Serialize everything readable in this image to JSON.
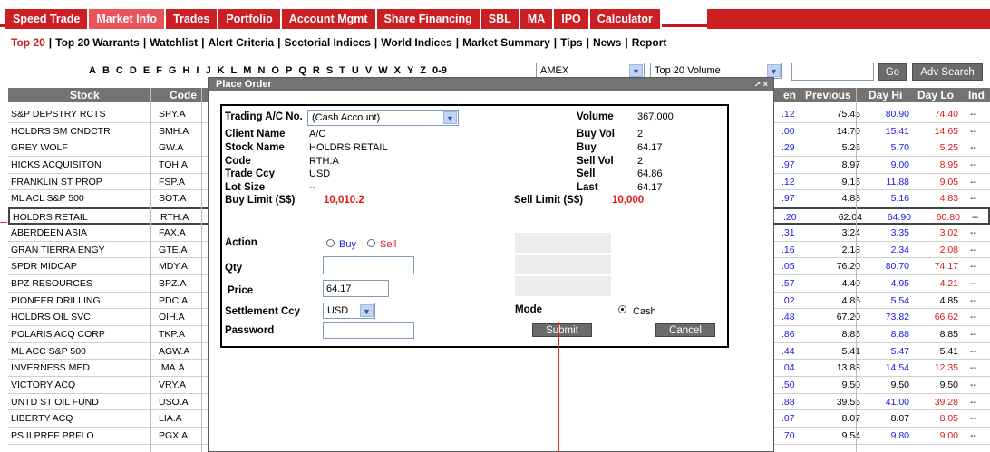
{
  "nav": {
    "tabs": [
      "Speed Trade",
      "Market Info",
      "Trades",
      "Portfolio",
      "Account Mgmt",
      "Share Financing",
      "SBL",
      "MA",
      "IPO",
      "Calculator"
    ],
    "active_tab": "Market Info"
  },
  "subnav": [
    "Top 20",
    "Top 20 Warrants",
    "Watchlist",
    "Alert Criteria",
    "Sectorial Indices",
    "World Indices",
    "Market Summary",
    "Tips",
    "News",
    "Report"
  ],
  "filter": {
    "letters": [
      "A",
      "B",
      "C",
      "D",
      "E",
      "F",
      "G",
      "H",
      "I",
      "J",
      "K",
      "L",
      "M",
      "N",
      "O",
      "P",
      "Q",
      "R",
      "S",
      "T",
      "U",
      "V",
      "W",
      "X",
      "Y",
      "Z",
      "0-9"
    ],
    "exchange": "AMEX",
    "list": "Top 20 Volume",
    "search_value": "",
    "go_label": "Go",
    "adv_search_label": "Adv Search"
  },
  "table": {
    "headers": {
      "stock": "Stock",
      "code": "Code",
      "open": "en",
      "previous": "Previous",
      "day_hi": "Day Hi",
      "day_lo": "Day Lo",
      "ind": "Ind"
    },
    "rows": [
      {
        "stock": "S&P DEPSTRY RCTS",
        "code": "SPY.A",
        "open": ".12",
        "previous": "75.45",
        "day_hi": "80.90",
        "day_lo": "74.40",
        "ind": "--"
      },
      {
        "stock": "HOLDRS SM CNDCTR",
        "code": "SMH.A",
        "open": ".00",
        "previous": "14.70",
        "day_hi": "15.41",
        "day_lo": "14.65",
        "ind": "--"
      },
      {
        "stock": "GREY WOLF",
        "code": "GW.A",
        "open": ".29",
        "previous": "5.26",
        "day_hi": "5.70",
        "day_lo": "5.25",
        "ind": "--"
      },
      {
        "stock": "HICKS ACQUISITON",
        "code": "TOH.A",
        "open": ".97",
        "previous": "8.97",
        "day_hi": "9.00",
        "day_lo": "8.95",
        "ind": "--"
      },
      {
        "stock": "FRANKLIN ST PROP",
        "code": "FSP.A",
        "open": ".12",
        "previous": "9.15",
        "day_hi": "11.88",
        "day_lo": "9.05",
        "ind": "--"
      },
      {
        "stock": "ML ACL S&P 500",
        "code": "SOT.A",
        "open": ".97",
        "previous": "4.88",
        "day_hi": "5.16",
        "day_lo": "4.83",
        "ind": "--"
      },
      {
        "stock": "HOLDRS RETAIL",
        "code": "RTH.A",
        "open": ".20",
        "previous": "62.04",
        "day_hi": "64.90",
        "day_lo": "60.80",
        "ind": "--"
      },
      {
        "stock": "ABERDEEN ASIA",
        "code": "FAX.A",
        "open": ".31",
        "previous": "3.24",
        "day_hi": "3.35",
        "day_lo": "3.02",
        "ind": "--"
      },
      {
        "stock": "GRAN TIERRA ENGY",
        "code": "GTE.A",
        "open": ".16",
        "previous": "2.18",
        "day_hi": "2.34",
        "day_lo": "2.08",
        "ind": "--"
      },
      {
        "stock": "SPDR MIDCAP",
        "code": "MDY.A",
        "open": ".05",
        "previous": "76.20",
        "day_hi": "80.70",
        "day_lo": "74.17",
        "ind": "--"
      },
      {
        "stock": "BPZ RESOURCES",
        "code": "BPZ.A",
        "open": ".57",
        "previous": "4.40",
        "day_hi": "4.95",
        "day_lo": "4.21",
        "ind": "--"
      },
      {
        "stock": "PIONEER DRILLING",
        "code": "PDC.A",
        "open": ".02",
        "previous": "4.85",
        "day_hi": "5.54",
        "day_lo": "4.85",
        "ind": "--"
      },
      {
        "stock": "HOLDRS OIL SVC",
        "code": "OIH.A",
        "open": ".48",
        "previous": "67.20",
        "day_hi": "73.82",
        "day_lo": "66.62",
        "ind": "--"
      },
      {
        "stock": "POLARIS ACQ CORP",
        "code": "TKP.A",
        "open": ".86",
        "previous": "8.85",
        "day_hi": "8.88",
        "day_lo": "8.85",
        "ind": "--"
      },
      {
        "stock": "ML ACC S&P 500",
        "code": "AGW.A",
        "open": ".44",
        "previous": "5.41",
        "day_hi": "5.47",
        "day_lo": "5.41",
        "ind": "--"
      },
      {
        "stock": "INVERNESS MED",
        "code": "IMA.A",
        "open": ".04",
        "previous": "13.88",
        "day_hi": "14.54",
        "day_lo": "12.35",
        "ind": "--"
      },
      {
        "stock": "VICTORY ACQ",
        "code": "VRY.A",
        "open": ".50",
        "previous": "9.50",
        "day_hi": "9.50",
        "day_lo": "9.50",
        "ind": "--"
      },
      {
        "stock": "UNTD ST OIL FUND",
        "code": "USO.A",
        "open": ".88",
        "previous": "39.55",
        "day_hi": "41.00",
        "day_lo": "39.28",
        "ind": "--"
      },
      {
        "stock": "LIBERTY ACQ",
        "code": "LIA.A",
        "open": ".07",
        "previous": "8.07",
        "day_hi": "8.07",
        "day_lo": "8.05",
        "ind": "--"
      },
      {
        "stock": "PS II PREF PRFLO",
        "code": "PGX.A",
        "open": ".70",
        "previous": "9.54",
        "day_hi": "9.80",
        "day_lo": "9.00",
        "ind": "--"
      }
    ]
  },
  "modal": {
    "title": "Place Order",
    "controls": "↗ ×",
    "trading_ac_label": "Trading A/C No.",
    "trading_ac_value": "(Cash Account)",
    "client_name_label": "Client Name",
    "client_name_value": "A/C",
    "stock_name_label": "Stock Name",
    "stock_name_value": "HOLDRS RETAIL",
    "code_label": "Code",
    "code_value": "RTH.A",
    "trade_ccy_label": "Trade Ccy",
    "trade_ccy_value": "USD",
    "lot_size_label": "Lot Size",
    "lot_size_value": "--",
    "buy_limit_label": "Buy Limit (S$)",
    "buy_limit_value": "10,010.2",
    "volume_label": "Volume",
    "volume_value": "367,000",
    "buy_vol_label": "Buy Vol",
    "buy_vol_value": "2",
    "buy_label": "Buy",
    "buy_value": "64.17",
    "sell_vol_label": "Sell Vol",
    "sell_vol_value": "2",
    "sell_label": "Sell",
    "sell_value": "64.86",
    "last_label": "Last",
    "last_value": "64.17",
    "sell_limit_label": "Sell Limit (S$)",
    "sell_limit_value": "10,000",
    "action_label": "Action",
    "action_buy": "Buy",
    "action_sell": "Sell",
    "qty_label": "Qty",
    "qty_value": "",
    "price_label": "Price",
    "price_value": "64.17",
    "settlement_ccy_label": "Settlement Ccy",
    "settlement_ccy_value": "USD",
    "password_label": "Password",
    "password_value": "",
    "mode_label": "Mode",
    "mode_value": "Cash",
    "submit_label": "Submit",
    "cancel_label": "Cancel"
  },
  "colors": {
    "nav_red": "#cc1f24",
    "active_tab": "#e8545a",
    "header_gray": "#737373",
    "price_blue": "#1a1ae6",
    "price_red": "#e01818"
  }
}
